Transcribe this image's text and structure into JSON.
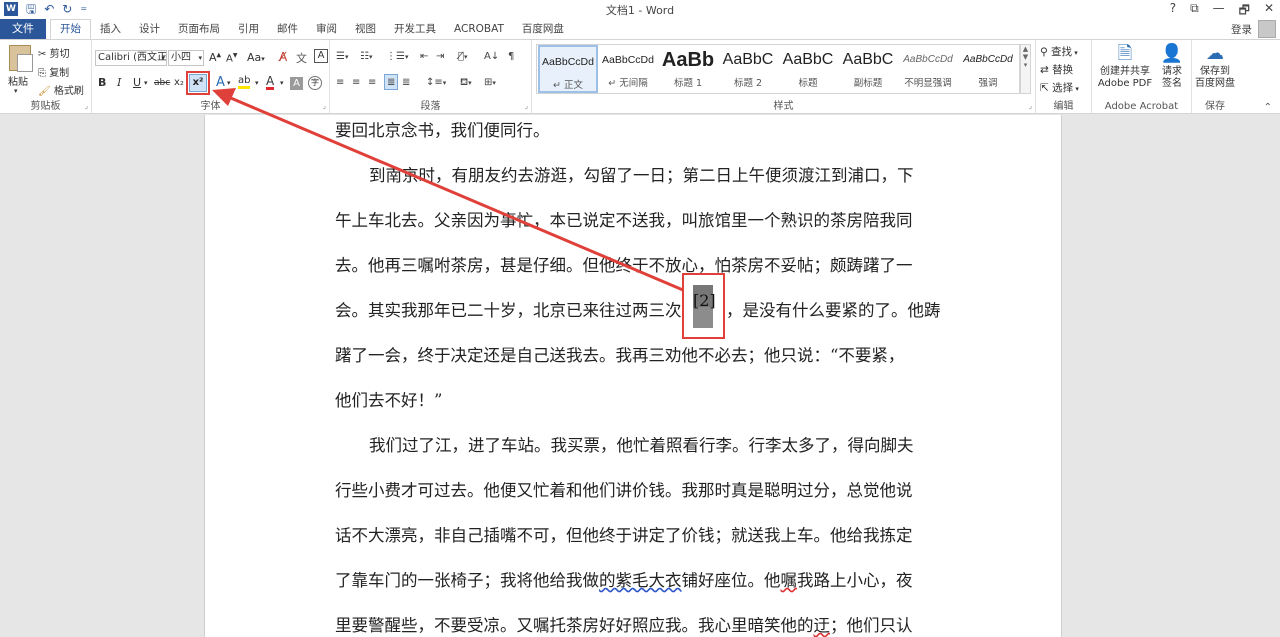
{
  "window": {
    "title": "文档1 - Word",
    "controls": [
      "?",
      "⧉",
      "—",
      "🗗",
      "✕"
    ],
    "login": "登录"
  },
  "qat": {
    "icons": [
      "word-app-icon",
      "save-icon",
      "undo-icon",
      "redo-icon",
      "customize-icon"
    ]
  },
  "tabs": {
    "file": "文件",
    "items": [
      "开始",
      "插入",
      "设计",
      "页面布局",
      "引用",
      "邮件",
      "审阅",
      "视图",
      "开发工具",
      "ACROBAT",
      "百度网盘"
    ],
    "active": "开始"
  },
  "ribbon": {
    "clipboard": {
      "label": "剪贴板",
      "paste": "粘贴",
      "cut": "剪切",
      "copy": "复制",
      "format_painter": "格式刷"
    },
    "font": {
      "label": "字体",
      "font_name": "Calibri (西文正",
      "font_size": "小四",
      "grow": "A",
      "shrink": "A",
      "case": "Aa",
      "bold": "B",
      "italic": "I",
      "underline": "U",
      "strike": "abc",
      "subscript": "x₂",
      "superscript": "x²",
      "text_effects": "A",
      "highlight": "ab",
      "font_color": "A",
      "shading": "A",
      "enclose": "字"
    },
    "paragraph": {
      "label": "段落"
    },
    "styles": {
      "label": "样式",
      "items": [
        {
          "sample": "AaBbCcDd",
          "name": "↵ 正文"
        },
        {
          "sample": "AaBbCcDd",
          "name": "↵ 无间隔"
        },
        {
          "sample": "AaBb",
          "name": "标题 1"
        },
        {
          "sample": "AaBbC",
          "name": "标题 2"
        },
        {
          "sample": "AaBbC",
          "name": "标题"
        },
        {
          "sample": "AaBbC",
          "name": "副标题"
        },
        {
          "sample": "AaBbCcDd",
          "name": "不明显强调"
        },
        {
          "sample": "AaBbCcDd",
          "name": "强调"
        }
      ]
    },
    "editing": {
      "label": "编辑",
      "find": "查找",
      "replace": "替换",
      "select": "选择"
    },
    "acrobat": {
      "label": "Adobe Acrobat",
      "create_pdf": [
        "创建并共享",
        "Adobe PDF"
      ],
      "request_sign": [
        "请求",
        "签名"
      ]
    },
    "save": {
      "label": "保存",
      "save_baidu": [
        "保存到",
        "百度网盘"
      ]
    }
  },
  "document": {
    "lines": [
      "要回北京念书，我们便同行。",
      "到南京时，有朋友约去游逛，勾留了一日；第二日上午便须渡江到浦口，下",
      "午上车北去。父亲因为事忙，本已说定不送我，叫旅馆里一个熟识的茶房陪我同",
      "去。他再三嘱咐茶房，甚是仔细。但他终于不放心，怕茶房不妥帖；颇踌躇了一",
      "会。其实我那年已二十岁，北京已来往过两三次",
      "，是没有什么要紧的了。他踌",
      "躇了一会，终于决定还是自己送我去。我再三劝他不必去；他只说：“不要紧，",
      "他们去不好！”",
      "我们过了江，进了车站。我买票，他忙着照看行李。行李太多了，得向脚夫",
      "行些小费才可过去。他便又忙着和他们讲价钱。我那时真是聪明过分，总觉他说",
      "话不大漂亮，非自己插嘴不可，但他终于讲定了价钱；就送我上车。他给我拣定",
      "了靠车门的一张椅子；我将他给我做",
      "的紫毛大衣",
      "铺好座位。他",
      "嘱",
      "我路上小心，夜",
      "里要警醒些，不要受凉。又嘱托茶房好好照应我。我心里暗笑他的",
      "迂",
      "；他们只认"
    ],
    "footnote_ref": "[2]"
  }
}
